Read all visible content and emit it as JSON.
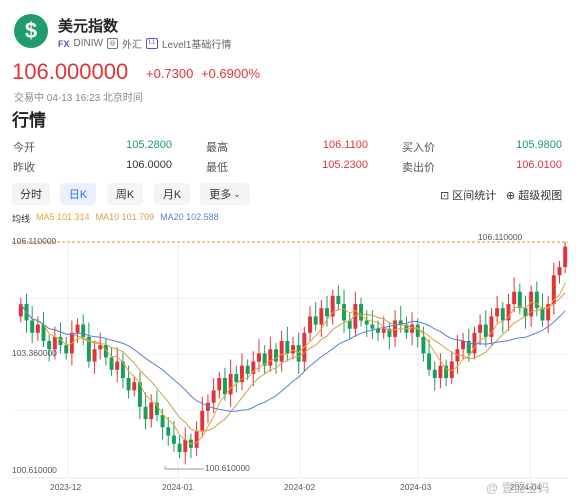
{
  "header": {
    "logo_glyph": "$",
    "name": "美元指数",
    "exchange_tag": "FX",
    "code": "DINIW",
    "market": "外汇",
    "level_tag": "L1",
    "level_label": "Level1基础行情"
  },
  "quote": {
    "price": "106.000000",
    "change": "+0.7300",
    "change_pct": "+0.6900%",
    "status": "交易中 04-13 16:23 北京时间"
  },
  "section_title": "行情",
  "stats": [
    {
      "label": "今开",
      "value": "105.2800",
      "color": "green"
    },
    {
      "label": "最高",
      "value": "106.1100",
      "color": "red"
    },
    {
      "label": "买入价",
      "value": "105.9800",
      "color": "green"
    },
    {
      "label": "昨收",
      "value": "106.0000",
      "color": "green"
    },
    {
      "label": "最低",
      "value": "105.2300",
      "color": "red"
    },
    {
      "label": "卖出价",
      "value": "106.0100",
      "color": "red"
    }
  ],
  "periods": [
    "分时",
    "日K",
    "周K",
    "月K",
    "更多"
  ],
  "active_period": "日K",
  "tools": {
    "range_stats": "区间统计",
    "zoom": "超级视图"
  },
  "ma": {
    "label": "均线",
    "ma5": "MA5 101.314",
    "ma10": "MA10 101.709",
    "ma20": "MA20 102.588"
  },
  "colors": {
    "up": "#e0343a",
    "down": "#1a9e5c",
    "ma5": "#e8a33a",
    "ma10": "#c9a14a",
    "ma20": "#5b7fd6",
    "accent": "#2f6ff0"
  },
  "chart": {
    "y_top_label": "106.110000",
    "y_mid_label": "103.360000",
    "y_bottom_label": "100.610000",
    "high_marker": "106.110000",
    "low_marker": "100.610000",
    "x_labels": [
      "2023-12",
      "2024-01",
      "2024-02",
      "2024-03",
      "2024-04"
    ],
    "watermark": "@ 壹盟宝妈"
  },
  "chart_data": {
    "type": "candlestick",
    "ylim": [
      100.61,
      106.11
    ],
    "closes": [
      104.6,
      104.2,
      103.9,
      104.1,
      103.7,
      103.5,
      103.8,
      103.6,
      103.4,
      103.9,
      104.1,
      103.8,
      103.2,
      103.5,
      103.6,
      103.3,
      103.0,
      103.2,
      102.8,
      102.5,
      102.7,
      102.1,
      101.8,
      102.2,
      101.9,
      101.6,
      101.4,
      101.2,
      101.0,
      101.3,
      101.1,
      101.5,
      102.0,
      102.2,
      102.5,
      102.8,
      102.4,
      102.9,
      102.7,
      103.1,
      102.9,
      103.2,
      103.4,
      103.1,
      103.5,
      103.2,
      103.7,
      103.4,
      103.6,
      103.2,
      103.9,
      104.3,
      104.1,
      104.5,
      104.3,
      104.8,
      104.6,
      104.2,
      104.0,
      104.6,
      104.2,
      104.1,
      104.0,
      103.9,
      104.0,
      103.8,
      104.2,
      104.1,
      103.9,
      104.1,
      103.8,
      103.4,
      103.0,
      102.8,
      103.1,
      102.8,
      103.2,
      103.5,
      103.7,
      103.4,
      103.9,
      104.1,
      103.8,
      104.3,
      104.5,
      104.2,
      104.6,
      104.9,
      104.5,
      104.3,
      104.9,
      104.5,
      104.2,
      104.6,
      105.3,
      105.5,
      106.0
    ],
    "opens": [
      104.3,
      104.6,
      104.2,
      103.9,
      104.1,
      103.7,
      103.5,
      103.8,
      103.6,
      103.4,
      103.9,
      104.1,
      103.8,
      103.2,
      103.5,
      103.6,
      103.3,
      103.0,
      103.2,
      102.8,
      102.5,
      102.7,
      102.1,
      101.8,
      102.2,
      101.9,
      101.6,
      101.4,
      101.2,
      101.0,
      101.3,
      101.1,
      101.5,
      102.0,
      102.2,
      102.5,
      102.8,
      102.4,
      102.9,
      102.7,
      103.1,
      102.9,
      103.2,
      103.4,
      103.1,
      103.5,
      103.2,
      103.7,
      103.4,
      103.6,
      103.2,
      103.9,
      104.3,
      104.1,
      104.5,
      104.3,
      104.8,
      104.6,
      104.2,
      104.0,
      104.6,
      104.2,
      104.1,
      104.0,
      103.9,
      104.0,
      103.8,
      104.2,
      104.1,
      103.9,
      104.1,
      103.8,
      103.4,
      103.0,
      102.8,
      103.1,
      102.8,
      103.2,
      103.5,
      103.7,
      103.4,
      103.9,
      104.1,
      103.8,
      104.3,
      104.5,
      104.2,
      104.6,
      104.9,
      104.5,
      104.3,
      104.9,
      104.5,
      104.2,
      104.6,
      105.3,
      105.5
    ]
  }
}
